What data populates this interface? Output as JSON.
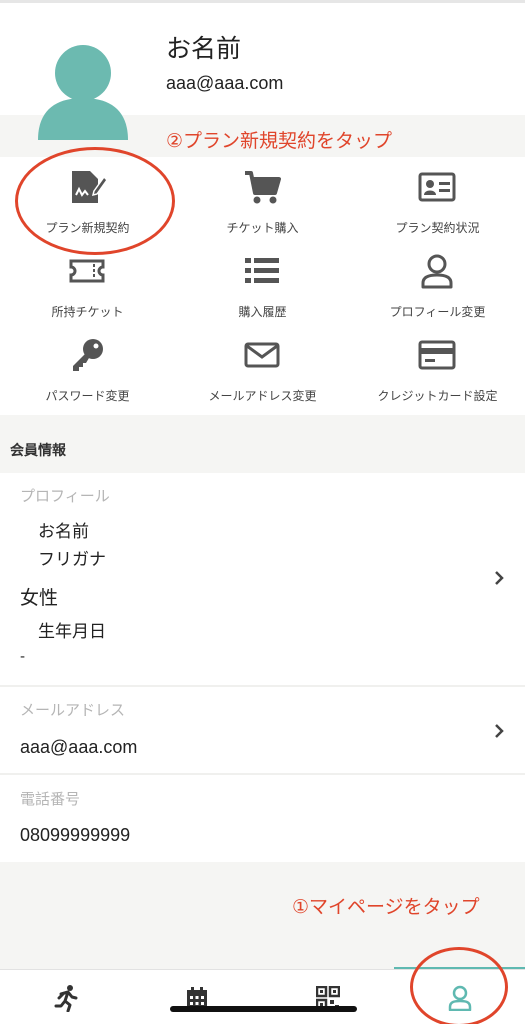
{
  "header": {
    "name": "お名前",
    "email": "aaa@aaa.com",
    "annotation_step2": "②プラン新規契約をタップ"
  },
  "menu": {
    "items": [
      {
        "label": "プラン新規契約",
        "icon": "contract-sign-icon"
      },
      {
        "label": "チケット購入",
        "icon": "shopping-cart-icon"
      },
      {
        "label": "プラン契約状況",
        "icon": "id-card-icon"
      },
      {
        "label": "所持チケット",
        "icon": "ticket-icon"
      },
      {
        "label": "購入履歴",
        "icon": "list-icon"
      },
      {
        "label": "プロフィール変更",
        "icon": "user-icon"
      },
      {
        "label": "パスワード変更",
        "icon": "key-icon"
      },
      {
        "label": "メールアドレス変更",
        "icon": "envelope-icon"
      },
      {
        "label": "クレジットカード設定",
        "icon": "credit-card-icon"
      }
    ]
  },
  "member_info": {
    "section_title": "会員情報",
    "profile": {
      "label": "プロフィール",
      "name": "お名前",
      "kana": "フリガナ",
      "gender": "女性",
      "birthday_label": "生年月日",
      "birthday_value": "-"
    },
    "email": {
      "label": "メールアドレス",
      "value": "aaa@aaa.com"
    },
    "phone": {
      "label": "電話番号",
      "value": "08099999999"
    }
  },
  "annotation_step1": "①マイページをタップ",
  "tabbar": {
    "tabs": [
      {
        "icon": "running-person-icon"
      },
      {
        "icon": "calendar-icon"
      },
      {
        "icon": "qr-code-icon"
      },
      {
        "icon": "user-icon",
        "active": true
      }
    ]
  },
  "colors": {
    "accent": "#5fb9b1",
    "annotation": "#e0452b",
    "icon": "#555555",
    "section_bg": "#f5f5f3"
  }
}
